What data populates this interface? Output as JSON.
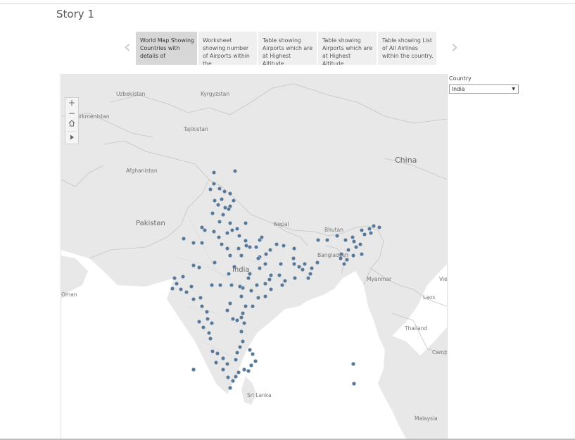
{
  "story": {
    "title": "Story 1"
  },
  "navigation": {
    "prev_icon": "chevron-left-icon",
    "next_icon": "chevron-right-icon"
  },
  "story_points": [
    {
      "caption": "World Map Showing Countries with details of",
      "active": true
    },
    {
      "caption": "Worksheet showing number of Airports within the",
      "active": false
    },
    {
      "caption": "Table showing Airports which are at Highest Altitude",
      "active": false
    },
    {
      "caption": "Table showing Airports which are at Highest Altitude",
      "active": false
    },
    {
      "caption": "Table showing List of All Airlines within the country.",
      "active": false
    }
  ],
  "map_controls": {
    "zoom_in": "+",
    "zoom_out": "−",
    "home_icon": "home-icon",
    "pan_icon": "play-icon"
  },
  "filter": {
    "label": "Country",
    "selected": "India"
  },
  "map": {
    "country_labels": {
      "uzbekistan": "Uzbekistan",
      "kyrgyzstan": "Kyrgyzstan",
      "turkmenistan": "Turkmenistan",
      "tajikistan": "Tajikistan",
      "afghanistan": "Afghanistan",
      "china": "China",
      "pakistan": "Pakistan",
      "nepal": "Nepal",
      "bhutan": "Bhutan",
      "bangladesh": "Bangladesh",
      "india": "India",
      "myanmar": "Myanmar",
      "oman": "Oman",
      "laos": "Laos",
      "thailand": "Thailand",
      "cambodia": "Camb",
      "vietnam": "Vie",
      "sri_lanka": "Sri Lanka",
      "malaysia": "Malaysia"
    },
    "colors": {
      "water": "#ffffff",
      "land": "#e8e8e8",
      "border": "#c4c4c4",
      "marker": "#587898"
    }
  }
}
